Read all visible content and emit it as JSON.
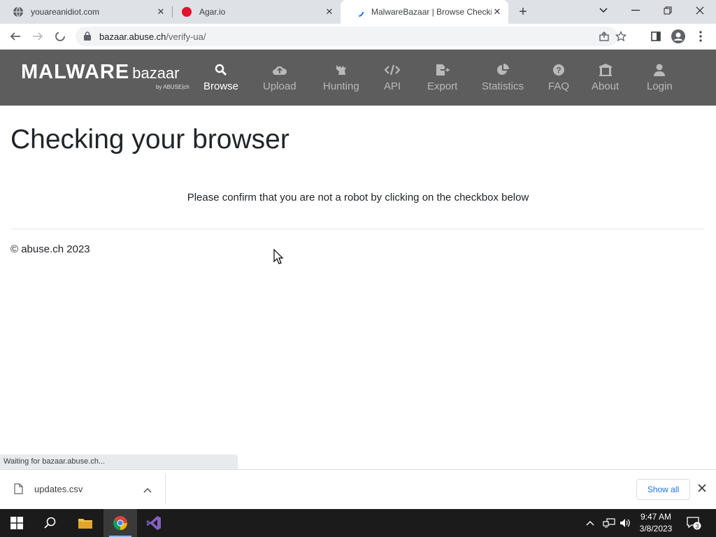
{
  "browser": {
    "tabs": [
      {
        "title": "youareanidiot.com",
        "icon": "globe-icon"
      },
      {
        "title": "Agar.io",
        "icon": "agar-favicon"
      },
      {
        "title": "MalwareBazaar | Browse Checkin",
        "icon": "loading-icon",
        "active": true
      }
    ],
    "url_host": "bazaar.abuse.ch",
    "url_path": "/verify-ua/"
  },
  "site": {
    "brand_main": "MALWARE",
    "brand_sub": "bazaar",
    "brand_by": "by ABUSE|ch",
    "nav": [
      {
        "label": "Browse",
        "icon": "search-icon",
        "active": true
      },
      {
        "label": "Upload",
        "icon": "cloud-upload-icon"
      },
      {
        "label": "Hunting",
        "icon": "hunting-icon"
      },
      {
        "label": "API",
        "icon": "code-icon"
      },
      {
        "label": "Export",
        "icon": "export-icon"
      },
      {
        "label": "Statistics",
        "icon": "pie-chart-icon"
      },
      {
        "label": "FAQ",
        "icon": "question-icon"
      },
      {
        "label": "About",
        "icon": "building-icon"
      },
      {
        "label": "Login",
        "icon": "user-icon"
      }
    ]
  },
  "main": {
    "title": "Checking your browser",
    "message": "Please confirm that you are not a robot by clicking on the checkbox below",
    "footer": "© abuse.ch 2023"
  },
  "status": {
    "text": "Waiting for bazaar.abuse.ch..."
  },
  "downloads": {
    "file": "updates.csv",
    "show_all": "Show all"
  },
  "taskbar": {
    "time": "9:47 AM",
    "date": "3/8/2023",
    "notifications": "3"
  }
}
